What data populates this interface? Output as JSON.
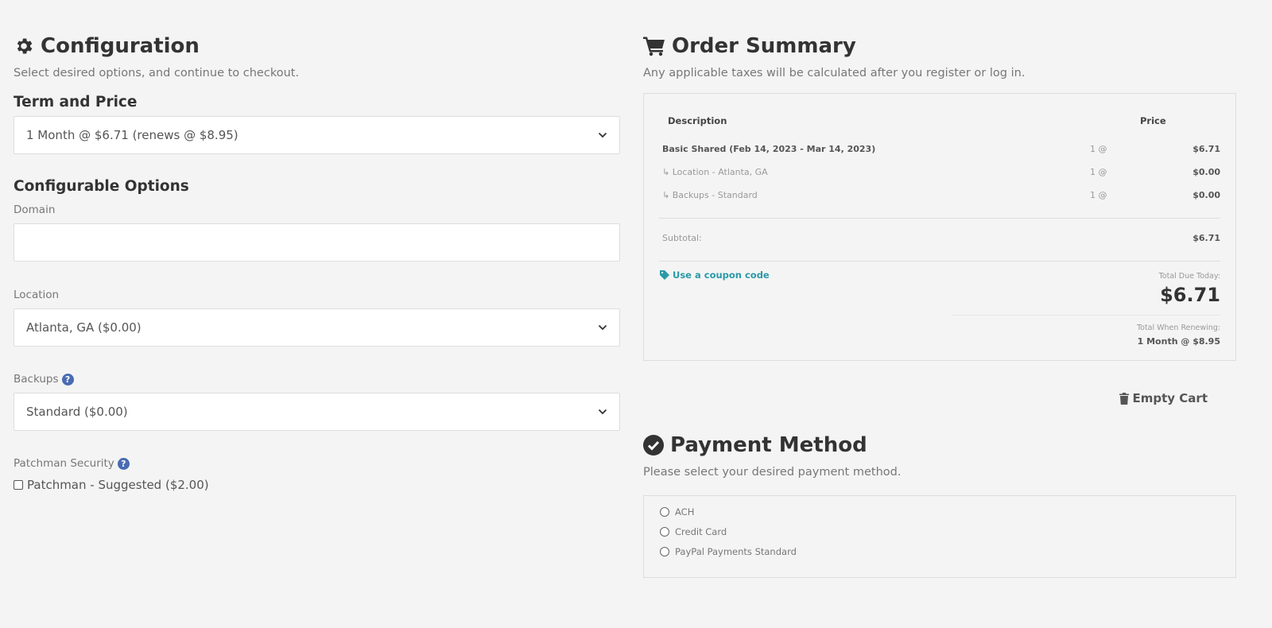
{
  "configuration": {
    "title": "Configuration",
    "subtitle": "Select desired options, and continue to checkout.",
    "term_heading": "Term and Price",
    "term_value": "1 Month @ $6.71 (renews @ $8.95)",
    "options_heading": "Configurable Options",
    "domain_label": "Domain",
    "domain_value": "",
    "location_label": "Location",
    "location_value": "Atlanta, GA ($0.00)",
    "backups_label": "Backups",
    "backups_value": "Standard ($0.00)",
    "patchman_label": "Patchman Security",
    "patchman_option": "Patchman - Suggested ($2.00)",
    "patchman_checked": false
  },
  "order_summary": {
    "title": "Order Summary",
    "subtitle": "Any applicable taxes will be calculated after you register or log in.",
    "col_description": "Description",
    "col_price": "Price",
    "items": [
      {
        "description": "Basic Shared (Feb 14, 2023 - Mar 14, 2023)",
        "qty": "1 @",
        "price": "$6.71"
      },
      {
        "description": "↳ Location - Atlanta, GA",
        "qty": "1 @",
        "price": "$0.00"
      },
      {
        "description": "↳ Backups - Standard",
        "qty": "1 @",
        "price": "$0.00"
      }
    ],
    "subtotal_label": "Subtotal:",
    "subtotal_value": "$6.71",
    "coupon_link": "Use a coupon code",
    "total_due_label": "Total Due Today:",
    "total_due_value": "$6.71",
    "renew_label": "Total When Renewing:",
    "renew_value": "1 Month @ $8.95",
    "empty_cart": "Empty Cart"
  },
  "payment": {
    "title": "Payment Method",
    "subtitle": "Please select your desired payment method.",
    "options": [
      "ACH",
      "Credit Card",
      "PayPal Payments Standard"
    ]
  },
  "colors": {
    "background": "#f4f4f4",
    "accent_link": "#2a9aa8",
    "help_icon": "#4a6bb3"
  }
}
